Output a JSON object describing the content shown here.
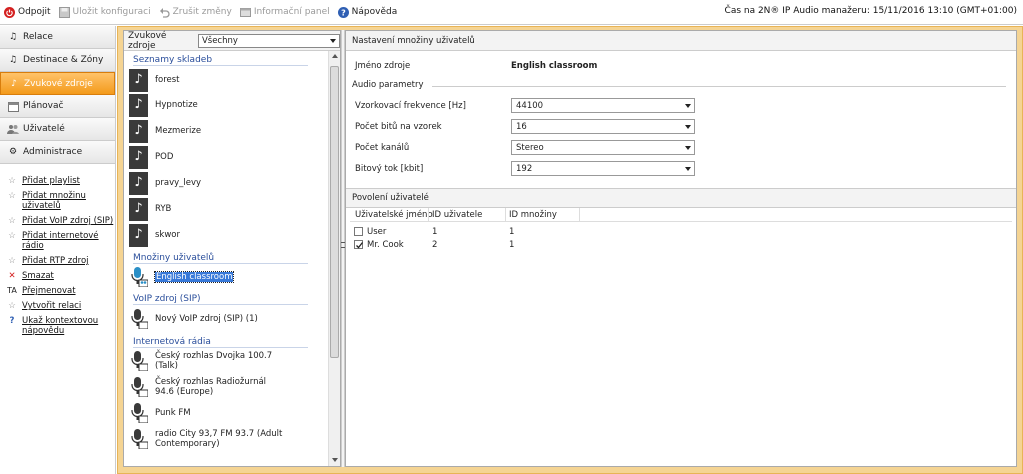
{
  "toolbar": {
    "disconnect": "Odpojit",
    "save_config": "Uložit konfiguraci",
    "undo": "Zrušit změny",
    "info_panel": "Informační panel",
    "help": "Nápověda",
    "time": "Čas na 2N® IP Audio manažeru: 15/11/2016 13:10 (GMT+01:00)"
  },
  "nav": [
    {
      "label": "Relace"
    },
    {
      "label": "Destinace & Zóny"
    },
    {
      "label": "Zvukové zdroje"
    },
    {
      "label": "Plánovač"
    },
    {
      "label": "Uživatelé"
    },
    {
      "label": "Administrace"
    }
  ],
  "actions": [
    {
      "label": "Přidat playlist"
    },
    {
      "label": "Přidat množinu uživatelů"
    },
    {
      "label": "Přidat VoIP zdroj (SIP)"
    },
    {
      "label": "Přidat internetové rádio"
    },
    {
      "label": "Přidat RTP zdroj"
    },
    {
      "label": "Smazat"
    },
    {
      "label": "Přejmenovat"
    },
    {
      "label": "Vytvořit relaci"
    },
    {
      "label": "Ukaž kontextovou nápovědu"
    }
  ],
  "sources": {
    "header_label": "Zvukové zdroje",
    "filter": "Všechny",
    "playlists_title": "Seznamy skladeb",
    "playlists": [
      "forest",
      "Hypnotize",
      "Mezmerize",
      "POD",
      "pravy_levy",
      "RYB",
      "skwor"
    ],
    "usersets_title": "Množiny uživatelů",
    "usersets": [
      "English classroom"
    ],
    "voip_title": "VoIP zdroj (SIP)",
    "voip": [
      "Nový VoIP zdroj (SIP) (1)"
    ],
    "radio_title": "Internetová rádia",
    "radios": [
      "Český rozhlas Dvojka 100.7 (Talk)",
      "Český rozhlas Radiožurnál 94.6 (Europe)",
      "Punk FM",
      "radio City 93,7 FM 93.7 (Adult Contemporary)"
    ]
  },
  "settings": {
    "title": "Nastavení množiny uživatelů",
    "name_label": "Jméno zdroje",
    "name_value": "English classroom",
    "audio_label": "Audio parametry",
    "sample_rate_label": "Vzorkovací frekvence [Hz]",
    "sample_rate": "44100",
    "bits_label": "Počet bitů na vzorek",
    "bits": "16",
    "channels_label": "Počet kanálů",
    "channels": "Stereo",
    "bitrate_label": "Bitový tok [kbit]",
    "bitrate": "192"
  },
  "allowed": {
    "title": "Povolení uživatelé",
    "columns": [
      "Uživatelské jméno",
      "ID uživatele",
      "ID množiny"
    ],
    "rows": [
      {
        "name": "User",
        "uid": "1",
        "sid": "1",
        "checked": false
      },
      {
        "name": "Mr. Cook",
        "uid": "2",
        "sid": "1",
        "checked": true
      }
    ]
  },
  "colors": {
    "accent": "#f39a1b",
    "section": "#2a4e9b"
  }
}
